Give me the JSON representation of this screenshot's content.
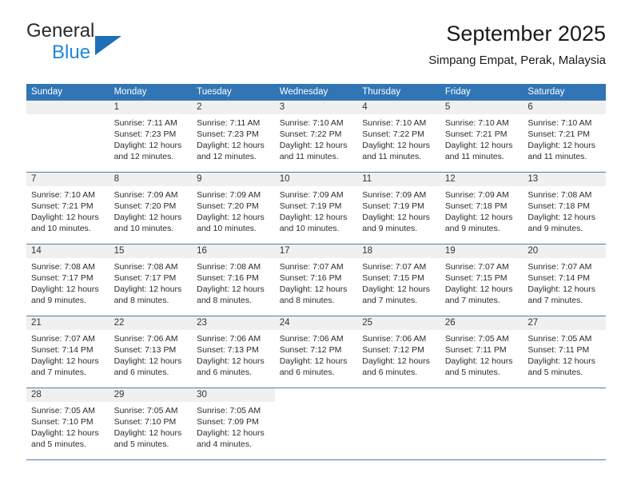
{
  "brand": {
    "line1": "General",
    "line2": "Blue",
    "triangle_color": "#1d70b8",
    "line2_color": "#1f87d8"
  },
  "header": {
    "title": "September 2025",
    "subtitle": "Simpang Empat, Perak, Malaysia"
  },
  "theme": {
    "header_bg": "#3175b4",
    "header_text": "#ffffff",
    "daynum_bg": "#f0f0f0",
    "row_line": "#4a7fb0"
  },
  "weekdays": [
    "Sunday",
    "Monday",
    "Tuesday",
    "Wednesday",
    "Thursday",
    "Friday",
    "Saturday"
  ],
  "weeks": [
    [
      {
        "day": "",
        "sunrise": "",
        "sunset": "",
        "daylight1": "",
        "daylight2": "",
        "blank": true
      },
      {
        "day": "1",
        "sunrise": "Sunrise: 7:11 AM",
        "sunset": "Sunset: 7:23 PM",
        "daylight1": "Daylight: 12 hours",
        "daylight2": "and 12 minutes."
      },
      {
        "day": "2",
        "sunrise": "Sunrise: 7:11 AM",
        "sunset": "Sunset: 7:23 PM",
        "daylight1": "Daylight: 12 hours",
        "daylight2": "and 12 minutes."
      },
      {
        "day": "3",
        "sunrise": "Sunrise: 7:10 AM",
        "sunset": "Sunset: 7:22 PM",
        "daylight1": "Daylight: 12 hours",
        "daylight2": "and 11 minutes."
      },
      {
        "day": "4",
        "sunrise": "Sunrise: 7:10 AM",
        "sunset": "Sunset: 7:22 PM",
        "daylight1": "Daylight: 12 hours",
        "daylight2": "and 11 minutes."
      },
      {
        "day": "5",
        "sunrise": "Sunrise: 7:10 AM",
        "sunset": "Sunset: 7:21 PM",
        "daylight1": "Daylight: 12 hours",
        "daylight2": "and 11 minutes."
      },
      {
        "day": "6",
        "sunrise": "Sunrise: 7:10 AM",
        "sunset": "Sunset: 7:21 PM",
        "daylight1": "Daylight: 12 hours",
        "daylight2": "and 11 minutes."
      }
    ],
    [
      {
        "day": "7",
        "sunrise": "Sunrise: 7:10 AM",
        "sunset": "Sunset: 7:21 PM",
        "daylight1": "Daylight: 12 hours",
        "daylight2": "and 10 minutes."
      },
      {
        "day": "8",
        "sunrise": "Sunrise: 7:09 AM",
        "sunset": "Sunset: 7:20 PM",
        "daylight1": "Daylight: 12 hours",
        "daylight2": "and 10 minutes."
      },
      {
        "day": "9",
        "sunrise": "Sunrise: 7:09 AM",
        "sunset": "Sunset: 7:20 PM",
        "daylight1": "Daylight: 12 hours",
        "daylight2": "and 10 minutes."
      },
      {
        "day": "10",
        "sunrise": "Sunrise: 7:09 AM",
        "sunset": "Sunset: 7:19 PM",
        "daylight1": "Daylight: 12 hours",
        "daylight2": "and 10 minutes."
      },
      {
        "day": "11",
        "sunrise": "Sunrise: 7:09 AM",
        "sunset": "Sunset: 7:19 PM",
        "daylight1": "Daylight: 12 hours",
        "daylight2": "and 9 minutes."
      },
      {
        "day": "12",
        "sunrise": "Sunrise: 7:09 AM",
        "sunset": "Sunset: 7:18 PM",
        "daylight1": "Daylight: 12 hours",
        "daylight2": "and 9 minutes."
      },
      {
        "day": "13",
        "sunrise": "Sunrise: 7:08 AM",
        "sunset": "Sunset: 7:18 PM",
        "daylight1": "Daylight: 12 hours",
        "daylight2": "and 9 minutes."
      }
    ],
    [
      {
        "day": "14",
        "sunrise": "Sunrise: 7:08 AM",
        "sunset": "Sunset: 7:17 PM",
        "daylight1": "Daylight: 12 hours",
        "daylight2": "and 9 minutes."
      },
      {
        "day": "15",
        "sunrise": "Sunrise: 7:08 AM",
        "sunset": "Sunset: 7:17 PM",
        "daylight1": "Daylight: 12 hours",
        "daylight2": "and 8 minutes."
      },
      {
        "day": "16",
        "sunrise": "Sunrise: 7:08 AM",
        "sunset": "Sunset: 7:16 PM",
        "daylight1": "Daylight: 12 hours",
        "daylight2": "and 8 minutes."
      },
      {
        "day": "17",
        "sunrise": "Sunrise: 7:07 AM",
        "sunset": "Sunset: 7:16 PM",
        "daylight1": "Daylight: 12 hours",
        "daylight2": "and 8 minutes."
      },
      {
        "day": "18",
        "sunrise": "Sunrise: 7:07 AM",
        "sunset": "Sunset: 7:15 PM",
        "daylight1": "Daylight: 12 hours",
        "daylight2": "and 7 minutes."
      },
      {
        "day": "19",
        "sunrise": "Sunrise: 7:07 AM",
        "sunset": "Sunset: 7:15 PM",
        "daylight1": "Daylight: 12 hours",
        "daylight2": "and 7 minutes."
      },
      {
        "day": "20",
        "sunrise": "Sunrise: 7:07 AM",
        "sunset": "Sunset: 7:14 PM",
        "daylight1": "Daylight: 12 hours",
        "daylight2": "and 7 minutes."
      }
    ],
    [
      {
        "day": "21",
        "sunrise": "Sunrise: 7:07 AM",
        "sunset": "Sunset: 7:14 PM",
        "daylight1": "Daylight: 12 hours",
        "daylight2": "and 7 minutes."
      },
      {
        "day": "22",
        "sunrise": "Sunrise: 7:06 AM",
        "sunset": "Sunset: 7:13 PM",
        "daylight1": "Daylight: 12 hours",
        "daylight2": "and 6 minutes."
      },
      {
        "day": "23",
        "sunrise": "Sunrise: 7:06 AM",
        "sunset": "Sunset: 7:13 PM",
        "daylight1": "Daylight: 12 hours",
        "daylight2": "and 6 minutes."
      },
      {
        "day": "24",
        "sunrise": "Sunrise: 7:06 AM",
        "sunset": "Sunset: 7:12 PM",
        "daylight1": "Daylight: 12 hours",
        "daylight2": "and 6 minutes."
      },
      {
        "day": "25",
        "sunrise": "Sunrise: 7:06 AM",
        "sunset": "Sunset: 7:12 PM",
        "daylight1": "Daylight: 12 hours",
        "daylight2": "and 6 minutes."
      },
      {
        "day": "26",
        "sunrise": "Sunrise: 7:05 AM",
        "sunset": "Sunset: 7:11 PM",
        "daylight1": "Daylight: 12 hours",
        "daylight2": "and 5 minutes."
      },
      {
        "day": "27",
        "sunrise": "Sunrise: 7:05 AM",
        "sunset": "Sunset: 7:11 PM",
        "daylight1": "Daylight: 12 hours",
        "daylight2": "and 5 minutes."
      }
    ],
    [
      {
        "day": "28",
        "sunrise": "Sunrise: 7:05 AM",
        "sunset": "Sunset: 7:10 PM",
        "daylight1": "Daylight: 12 hours",
        "daylight2": "and 5 minutes."
      },
      {
        "day": "29",
        "sunrise": "Sunrise: 7:05 AM",
        "sunset": "Sunset: 7:10 PM",
        "daylight1": "Daylight: 12 hours",
        "daylight2": "and 5 minutes."
      },
      {
        "day": "30",
        "sunrise": "Sunrise: 7:05 AM",
        "sunset": "Sunset: 7:09 PM",
        "daylight1": "Daylight: 12 hours",
        "daylight2": "and 4 minutes."
      },
      {
        "day": "",
        "sunrise": "",
        "sunset": "",
        "daylight1": "",
        "daylight2": "",
        "blank": true
      },
      {
        "day": "",
        "sunrise": "",
        "sunset": "",
        "daylight1": "",
        "daylight2": "",
        "blank": true
      },
      {
        "day": "",
        "sunrise": "",
        "sunset": "",
        "daylight1": "",
        "daylight2": "",
        "blank": true
      },
      {
        "day": "",
        "sunrise": "",
        "sunset": "",
        "daylight1": "",
        "daylight2": "",
        "blank": true
      }
    ]
  ]
}
